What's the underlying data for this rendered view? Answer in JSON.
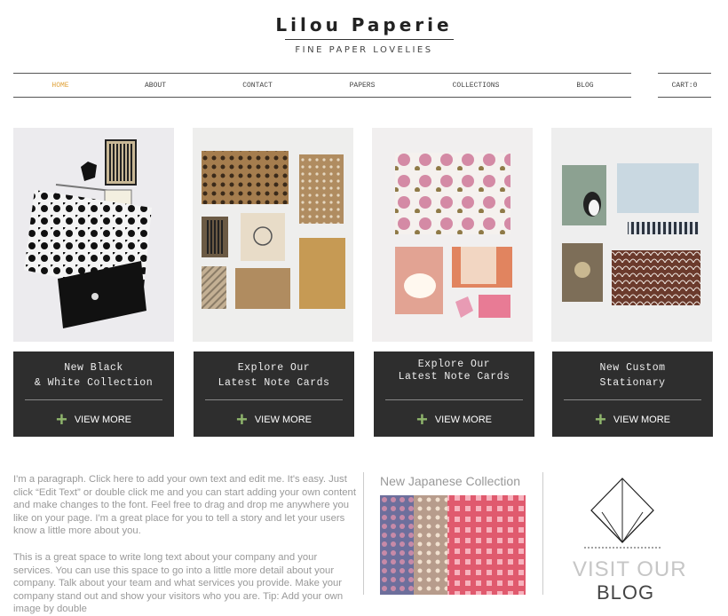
{
  "site": {
    "brand": "Lilou Paperie",
    "tagline": "FINE PAPER LOVELIES"
  },
  "nav": {
    "items": [
      {
        "label": "HOME",
        "active": true
      },
      {
        "label": "ABOUT"
      },
      {
        "label": "CONTACT"
      },
      {
        "label": "PAPERS"
      },
      {
        "label": "COLLECTIONS"
      },
      {
        "label": "BLOG"
      }
    ],
    "cart": "CART:0",
    "active_color": "#e0a23a"
  },
  "cards": [
    {
      "line1": "New Black",
      "line2": "& White Collection",
      "cta": "VIEW MORE"
    },
    {
      "line1": "Explore Our",
      "line2": "Latest Note Cards",
      "cta": "VIEW MORE"
    },
    {
      "line1": "Explore Our",
      "line2": "Latest Note Cards",
      "cta": "VIEW MORE"
    },
    {
      "line1": "New Custom",
      "line2": "Stationary",
      "cta": "VIEW MORE"
    }
  ],
  "about": {
    "paragraph1": "I'm a paragraph. Click here to add your own text and edit me. It's easy. Just click “Edit Text” or double click me and you can start adding your own content and make changes to the font. Feel free to drag and drop me anywhere you like on your page. I'm a great place for you to tell a story and let your users know a little more about you.",
    "paragraph2": "This is a great space to write long text about your company and your services. You can use this space to go into a little more detail about your company. Talk about your team and what services you provide. Make your company stand out and show your visitors who you are. Tip: Add your own image by double"
  },
  "japanese": {
    "title": "New Japanese Collection"
  },
  "blog": {
    "line1": "VISIT OUR",
    "line2": "BLOG"
  }
}
